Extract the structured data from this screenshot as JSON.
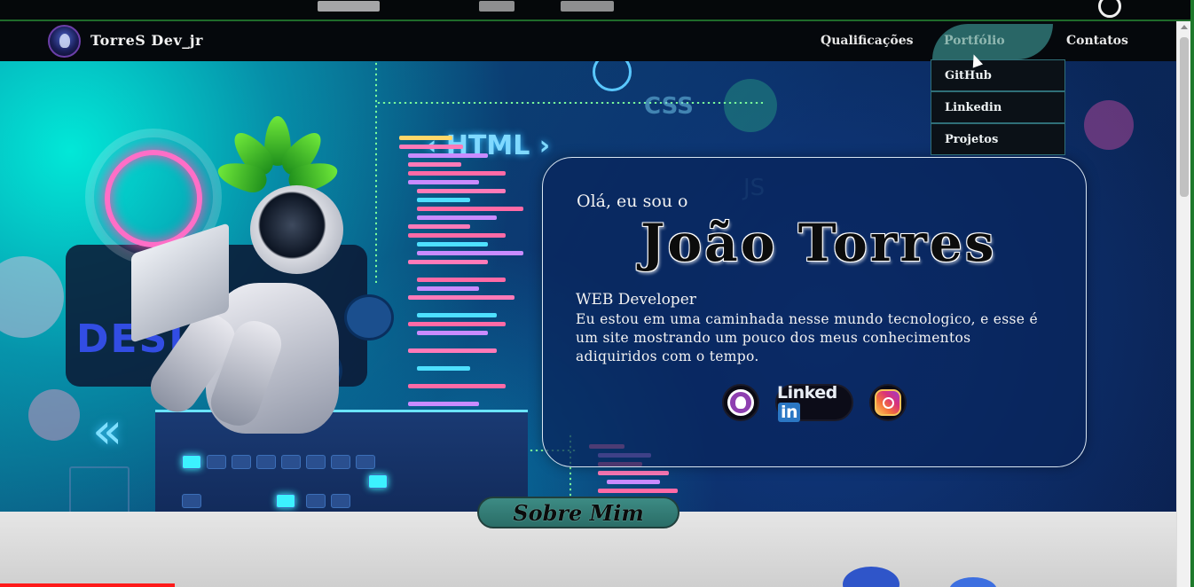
{
  "brand": {
    "name": "TorreS Dev_jr"
  },
  "nav": {
    "items": [
      {
        "label": "Qualificações"
      },
      {
        "label": "Portfólio"
      },
      {
        "label": "Contatos"
      }
    ],
    "dropdown": [
      {
        "label": "GitHub"
      },
      {
        "label": "Linkedin"
      },
      {
        "label": "Projetos"
      }
    ]
  },
  "hero": {
    "decor_text": {
      "html": "HTML",
      "css": "CSS",
      "js": "JS",
      "design": "DESIG",
      "chevrons": "«"
    }
  },
  "intro": {
    "greeting": "Olá, eu sou o",
    "name": "João Torres",
    "role": "WEB Developer",
    "description": "Eu estou em uma caminhada nesse mundo tecnologico, e esse é um site mostrando um pouco dos meus conhecimentos adiquiridos com o tempo."
  },
  "social": {
    "linkedin_text": "Linked",
    "linkedin_box": "in"
  },
  "about": {
    "button_label": "Sobre Mim"
  },
  "colors": {
    "nav_bg": "#05080c",
    "accent_teal": "#2b6b6b",
    "card_border": "#d9e6f2",
    "brand_purple": "#6b3fa8"
  },
  "icons": {
    "github": "github-icon",
    "linkedin": "linkedin-icon",
    "instagram": "instagram-icon",
    "logo": "logo-avatar"
  }
}
